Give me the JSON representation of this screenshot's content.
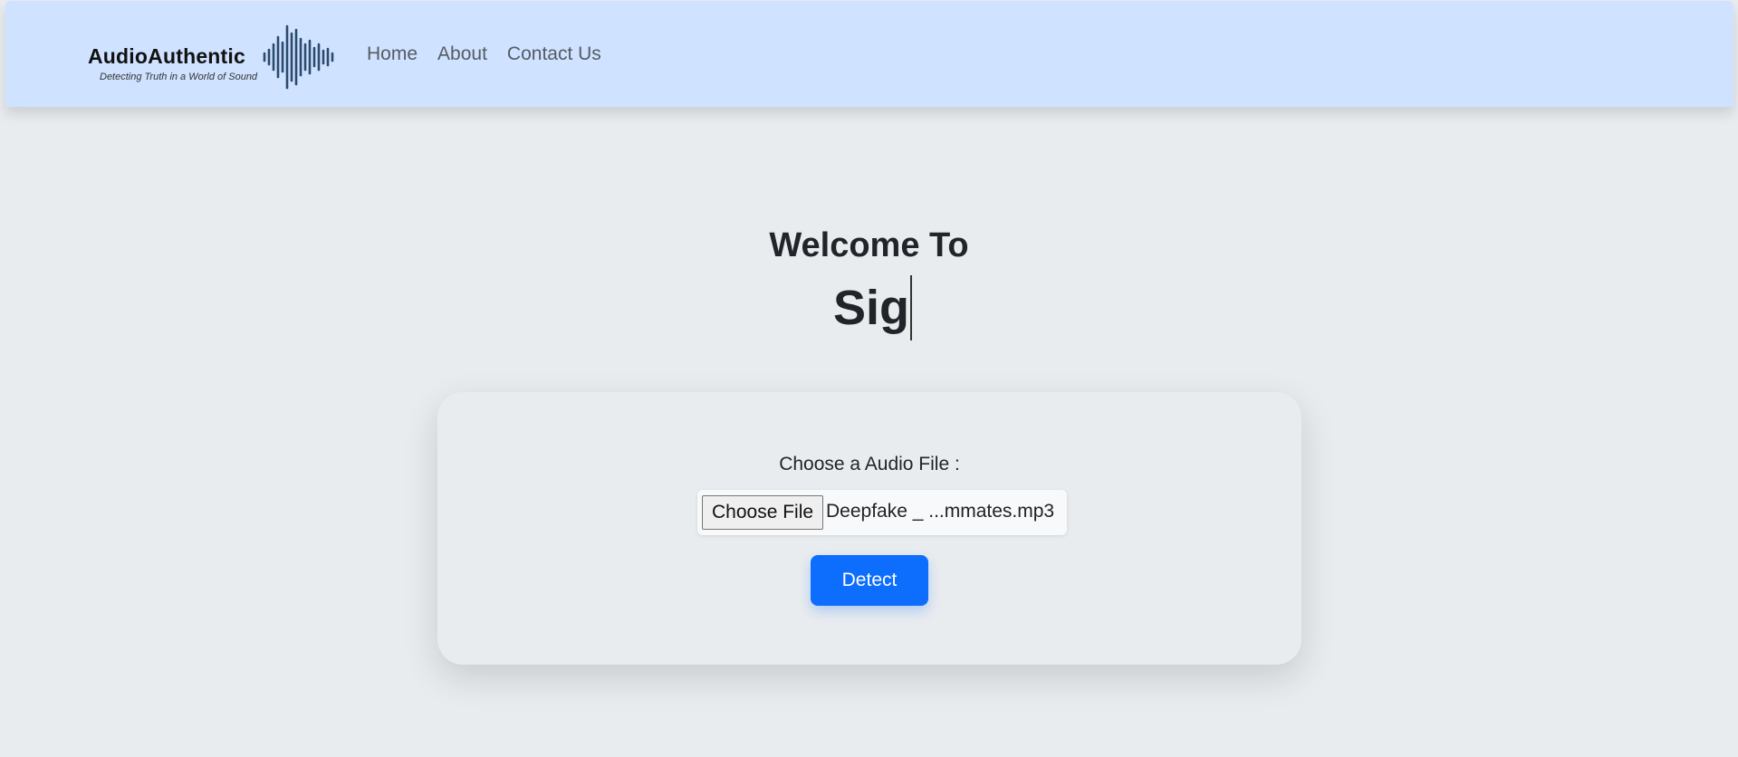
{
  "colors": {
    "navbar_bg": "#cfe2ff",
    "page_bg": "#e9ecef",
    "primary": "#0d6efd",
    "brand_wave": "#2b4a6f"
  },
  "brand": {
    "name": "AudioAuthentic",
    "tagline": "Detecting Truth in a World of Sound",
    "logo_icon": "sound-wave-icon"
  },
  "nav": {
    "items": [
      {
        "label": "Home"
      },
      {
        "label": "About"
      },
      {
        "label": "Contact Us"
      }
    ]
  },
  "hero": {
    "title": "Welcome To",
    "typed_text": "Sig"
  },
  "upload": {
    "label": "Choose a Audio File :",
    "choose_button": "Choose File",
    "file_name": "Deepfake _ ...mmates.mp3",
    "detect_button": "Detect"
  }
}
